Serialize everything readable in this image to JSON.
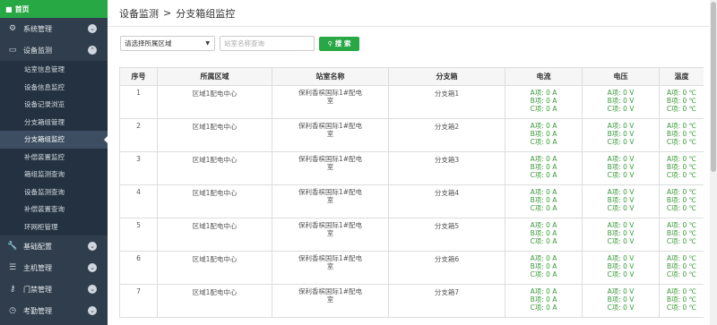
{
  "sidebar": {
    "home_label": "首页",
    "menus": [
      {
        "label": "系统管理",
        "icon": "gear-icon"
      },
      {
        "label": "设备监测",
        "icon": "monitor-icon"
      }
    ],
    "sub_items": [
      "站室信息管理",
      "设备信息监控",
      "设备记录浏览",
      "分支箱组管理",
      "分支箱组监控",
      "补偿装置监控",
      "箱组监测查询",
      "设备监测查询",
      "补偿装置查询",
      "环网柜管理"
    ],
    "bottom_menus": [
      {
        "label": "基础配置",
        "icon": "wrench-icon"
      },
      {
        "label": "主机管理",
        "icon": "list-icon"
      },
      {
        "label": "门禁管理",
        "icon": "key-icon"
      },
      {
        "label": "考勤管理",
        "icon": "clock-icon"
      }
    ]
  },
  "breadcrumb": {
    "parent": "设备监测",
    "separator": ">",
    "current": "分支箱组监控"
  },
  "filters": {
    "area_select": "请选择所属区域",
    "station_placeholder": "站室名称查询",
    "search_label": "搜 索"
  },
  "table": {
    "headers": [
      "序号",
      "所属区域",
      "站室名称",
      "分支箱",
      "电流",
      "电压",
      "温度"
    ],
    "rows": [
      {
        "no": "1",
        "area": "区域1配电中心",
        "station_l1": "保利香槟国际1#配电",
        "station_l2": "室",
        "box": "分支箱1",
        "current": [
          "A项: 0 A",
          "B项: 0 A",
          "C项: 0 A"
        ],
        "voltage": [
          "A项: 0 V",
          "B项: 0 V",
          "C项: 0 V"
        ],
        "temp": [
          "A项: 0 ℃",
          "B项: 0 ℃",
          "C项: 0 ℃"
        ]
      },
      {
        "no": "2",
        "area": "区域1配电中心",
        "station_l1": "保利香槟国际1#配电",
        "station_l2": "室",
        "box": "分支箱2",
        "current": [
          "A项: 0 A",
          "B项: 0 A",
          "C项: 0 A"
        ],
        "voltage": [
          "A项: 0 V",
          "B项: 0 V",
          "C项: 0 V"
        ],
        "temp": [
          "A项: 0 ℃",
          "B项: 0 ℃",
          "C项: 0 ℃"
        ]
      },
      {
        "no": "3",
        "area": "区域1配电中心",
        "station_l1": "保利香槟国际1#配电",
        "station_l2": "室",
        "box": "分支箱3",
        "current": [
          "A项: 0 A",
          "B项: 0 A",
          "C项: 0 A"
        ],
        "voltage": [
          "A项: 0 V",
          "B项: 0 V",
          "C项: 0 V"
        ],
        "temp": [
          "A项: 0 ℃",
          "B项: 0 ℃",
          "C项: 0 ℃"
        ]
      },
      {
        "no": "4",
        "area": "区域1配电中心",
        "station_l1": "保利香槟国际1#配电",
        "station_l2": "室",
        "box": "分支箱4",
        "current": [
          "A项: 0 A",
          "B项: 0 A",
          "C项: 0 A"
        ],
        "voltage": [
          "A项: 0 V",
          "B项: 0 V",
          "C项: 0 V"
        ],
        "temp": [
          "A项: 0 ℃",
          "B项: 0 ℃",
          "C项: 0 ℃"
        ]
      },
      {
        "no": "5",
        "area": "区域1配电中心",
        "station_l1": "保利香槟国际1#配电",
        "station_l2": "室",
        "box": "分支箱5",
        "current": [
          "A项: 0 A",
          "B项: 0 A",
          "C项: 0 A"
        ],
        "voltage": [
          "A项: 0 V",
          "B项: 0 V",
          "C项: 0 V"
        ],
        "temp": [
          "A项: 0 ℃",
          "B项: 0 ℃",
          "C项: 0 ℃"
        ]
      },
      {
        "no": "6",
        "area": "区域1配电中心",
        "station_l1": "保利香槟国际1#配电",
        "station_l2": "室",
        "box": "分支箱6",
        "current": [
          "A项: 0 A",
          "B项: 0 A",
          "C项: 0 A"
        ],
        "voltage": [
          "A项: 0 V",
          "B项: 0 V",
          "C项: 0 V"
        ],
        "temp": [
          "A项: 0 ℃",
          "B项: 0 ℃",
          "C项: 0 ℃"
        ]
      },
      {
        "no": "7",
        "area": "区域1配电中心",
        "station_l1": "保利香槟国际1#配电",
        "station_l2": "室",
        "box": "分支箱7",
        "current": [
          "A项: 0 A",
          "B项: 0 A",
          "C项: 0 A"
        ],
        "voltage": [
          "A项: 0 V",
          "B项: 0 V",
          "C项: 0 V"
        ],
        "temp": [
          "A项: 0 ℃",
          "B项: 0 ℃",
          "C项: 0 ℃"
        ]
      }
    ]
  },
  "colors": {
    "sidebar_bg": "#2f3d4c",
    "accent_green": "#28a745",
    "value_green": "#3a9a3a"
  }
}
